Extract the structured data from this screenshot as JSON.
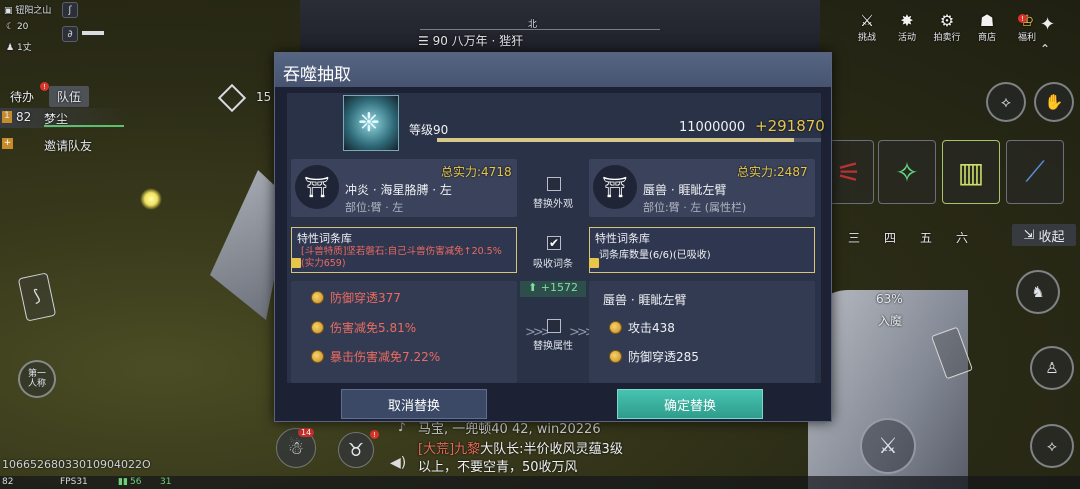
{
  "hud": {
    "location": "钮阳之山",
    "weather": "20",
    "team_size": "1丈",
    "compass": "北",
    "target": "90 八万年 · 狴犴",
    "fps": "FPS31",
    "ping1": "56",
    "ping2": "31",
    "ping_left": "82",
    "uid": "10665268033010904022O",
    "level_badge": "15"
  },
  "team": {
    "tab_todo": "待办",
    "tab_team": "队伍",
    "member_level": "82",
    "member_name": "梦尘",
    "invite": "邀请队友",
    "first_person": "第一\n人称"
  },
  "right_menu": [
    {
      "label": "挑战",
      "icon": "⚔"
    },
    {
      "label": "活动",
      "icon": "✸"
    },
    {
      "label": "拍卖行",
      "icon": "⚙"
    },
    {
      "label": "商店",
      "icon": "☗"
    },
    {
      "label": "福利",
      "icon": "♔"
    }
  ],
  "right_hud": {
    "skill_tabs": [
      "三",
      "四",
      "五",
      "六"
    ],
    "collapse": "收起",
    "percent": "63%",
    "enter_demon": "入魔"
  },
  "dialog": {
    "title": "吞噬抽取",
    "level_label": "等级90",
    "exp": "11000000",
    "exp_gain": "+291870",
    "exp_ratio": 0.93,
    "left_item": {
      "power": "总实力:4718",
      "name": "冲炎 · 海星胳膊 · 左",
      "part": "部位:臂 · 左"
    },
    "right_item": {
      "power": "总实力:2487",
      "name": "蜃兽 · 睚眦左臂",
      "part": "部位:臂 · 左 (属性栏)"
    },
    "swap_look": "替换外观",
    "absorb_entry": "吸收词条",
    "swap_attr": "替换属性",
    "left_lib": {
      "title": "特性词条库",
      "text": "[斗兽特质]坚若磐石:自己斗兽伤害减免↑20.5%(实力659)"
    },
    "right_lib": {
      "title": "特性词条库",
      "text": "词条库数量(6/6)(已吸收)"
    },
    "diff": "+1572",
    "left_attrs": [
      "防御穿透377",
      "伤害减免5.81%",
      "暴击伤害减免7.22%"
    ],
    "right_name": "蜃兽 · 睚眦左臂",
    "right_attrs": [
      "攻击438",
      "防御穿透285"
    ],
    "cancel": "取消替换",
    "confirm": "确定替换"
  },
  "chat": {
    "line0": "马宝, 一兜顿40 42, win20226",
    "tag": "[大荒]",
    "speaker": "九黎",
    "line1": "大队长:半价收风灵蕴3级",
    "line2": "以上，不要空青，50收万风",
    "badge": "14"
  },
  "colors": {
    "accent_gold": "#e8c64a",
    "attr_red": "#ec6b60",
    "confirm_bg": "#3fb8a6"
  }
}
